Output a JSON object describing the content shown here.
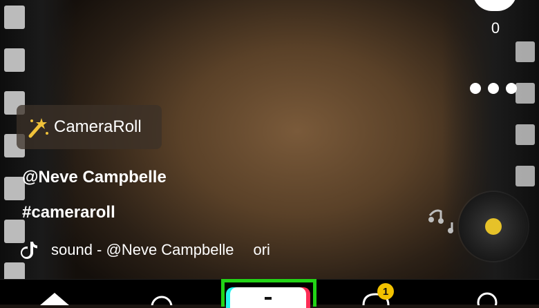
{
  "video": {
    "effect": {
      "label": "CameraRoll",
      "icon": "magic-wand-icon"
    },
    "username": "@Neve Campbelle",
    "hashtag": "#cameraroll",
    "sound": {
      "text": "sound - @Neve Campbelle",
      "text_cont": "ori",
      "icon": "tiktok-note-icon"
    }
  },
  "actions": {
    "comments": {
      "icon": "comment-icon",
      "count": "0"
    },
    "more": {
      "icon": "more-dots-icon"
    },
    "disc": {
      "icon": "music-disc-icon",
      "center_color": "#e6c229"
    }
  },
  "nav": {
    "items": [
      {
        "icon": "home-icon"
      },
      {
        "icon": "search-icon"
      },
      {
        "icon": "create-plus-icon",
        "highlight_color": "#22d416"
      },
      {
        "icon": "inbox-icon",
        "badge": "1"
      },
      {
        "icon": "profile-icon"
      }
    ]
  },
  "colors": {
    "highlight_box": "#22d416",
    "badge": "#f2c200",
    "cyan_accent": "#25f4ee",
    "red_accent": "#fe2c55"
  }
}
